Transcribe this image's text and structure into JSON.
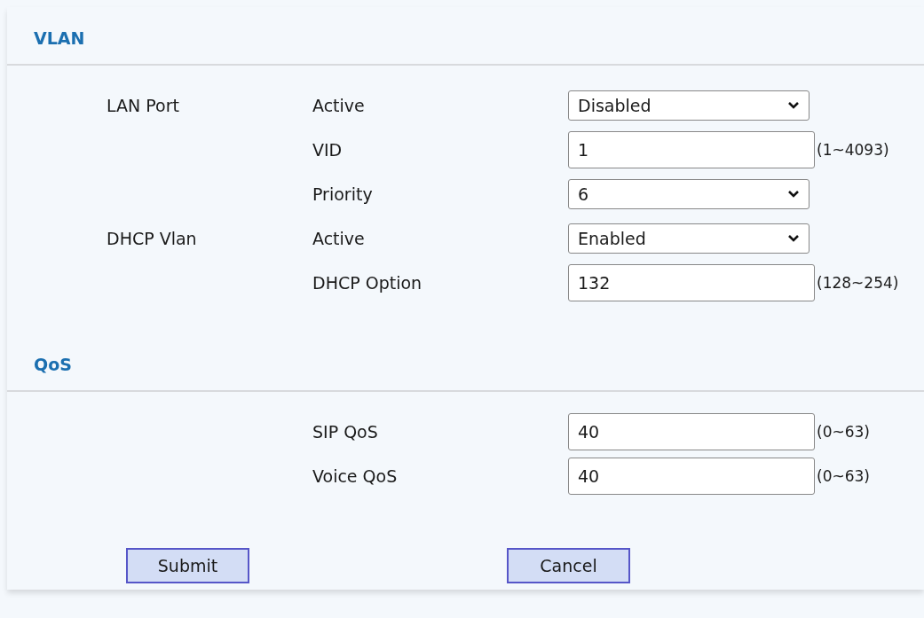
{
  "sections": [
    {
      "title": "VLAN",
      "rows": [
        {
          "group": "LAN Port",
          "label": "Active",
          "kind": "select",
          "value": "Disabled"
        },
        {
          "label": "VID",
          "kind": "text",
          "value": "1",
          "hint": "(1~4093)"
        },
        {
          "label": "Priority",
          "kind": "select",
          "value": "6"
        },
        {
          "group": "DHCP Vlan",
          "label": "Active",
          "kind": "select",
          "value": "Enabled"
        },
        {
          "label": "DHCP Option",
          "kind": "text",
          "value": "132",
          "hint": "(128~254)"
        }
      ]
    },
    {
      "title": "QoS",
      "rows": [
        {
          "label": "SIP QoS",
          "kind": "text",
          "value": "40",
          "hint": "(0~63)"
        },
        {
          "label": "Voice QoS",
          "kind": "text",
          "value": "40",
          "hint": "(0~63)"
        }
      ]
    }
  ],
  "buttons": [
    "Submit",
    "Cancel"
  ]
}
